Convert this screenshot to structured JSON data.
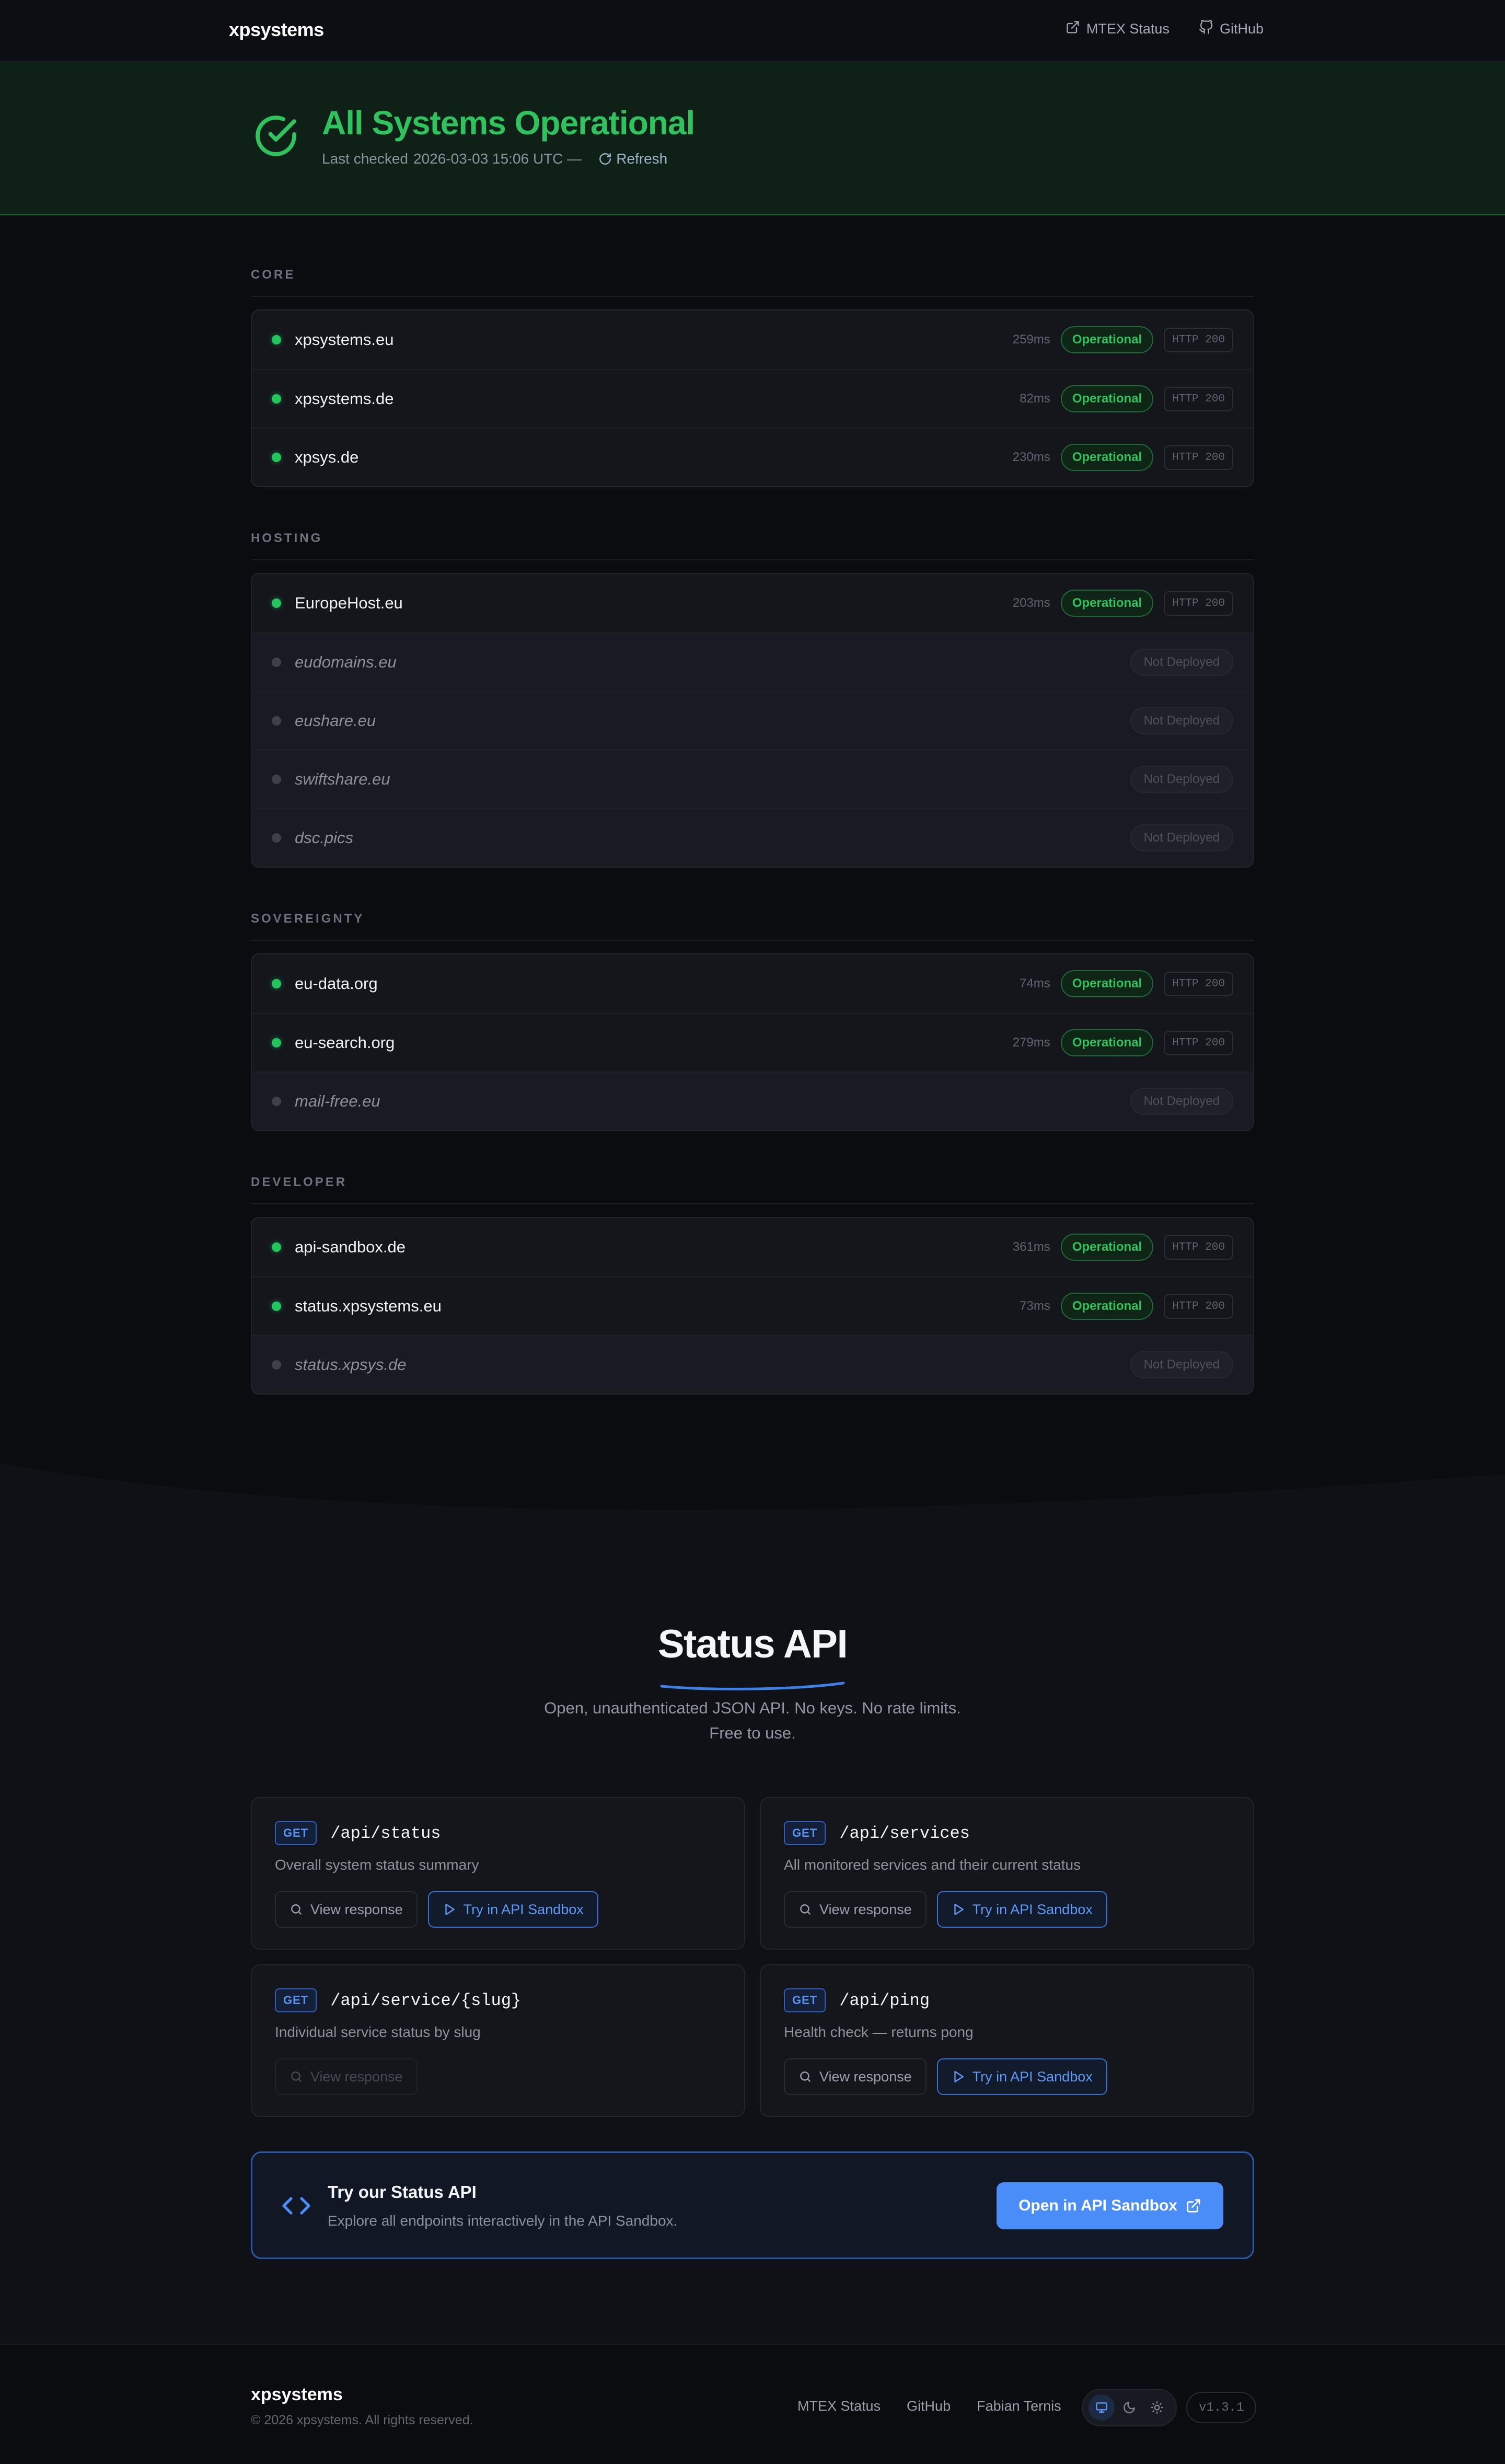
{
  "nav": {
    "logo": "xpsystems",
    "links": [
      {
        "label": "MTEX Status",
        "icon": "external-link-icon"
      },
      {
        "label": "GitHub",
        "icon": "github-icon"
      }
    ]
  },
  "hero": {
    "title": "All Systems Operational",
    "last_checked_label": "Last checked",
    "last_checked_value": "2026-03-03 15:06 UTC —",
    "refresh_label": "Refresh"
  },
  "groups": [
    {
      "label": "CORE",
      "services": [
        {
          "name": "xpsystems.eu",
          "ms": "259ms",
          "status": "Operational",
          "http": "HTTP 200"
        },
        {
          "name": "xpsystems.de",
          "ms": "82ms",
          "status": "Operational",
          "http": "HTTP 200"
        },
        {
          "name": "xpsys.de",
          "ms": "230ms",
          "status": "Operational",
          "http": "HTTP 200"
        }
      ]
    },
    {
      "label": "HOSTING",
      "services": [
        {
          "name": "EuropeHost.eu",
          "ms": "203ms",
          "status": "Operational",
          "http": "HTTP 200"
        },
        {
          "name": "eudomains.eu",
          "status": "Not Deployed"
        },
        {
          "name": "eushare.eu",
          "status": "Not Deployed"
        },
        {
          "name": "swiftshare.eu",
          "status": "Not Deployed"
        },
        {
          "name": "dsc.pics",
          "status": "Not Deployed"
        }
      ]
    },
    {
      "label": "SOVEREIGNTY",
      "services": [
        {
          "name": "eu-data.org",
          "ms": "74ms",
          "status": "Operational",
          "http": "HTTP 200"
        },
        {
          "name": "eu-search.org",
          "ms": "279ms",
          "status": "Operational",
          "http": "HTTP 200"
        },
        {
          "name": "mail-free.eu",
          "status": "Not Deployed"
        }
      ]
    },
    {
      "label": "DEVELOPER",
      "services": [
        {
          "name": "api-sandbox.de",
          "ms": "361ms",
          "status": "Operational",
          "http": "HTTP 200"
        },
        {
          "name": "status.xpsystems.eu",
          "ms": "73ms",
          "status": "Operational",
          "http": "HTTP 200"
        },
        {
          "name": "status.xpsys.de",
          "status": "Not Deployed"
        }
      ]
    }
  ],
  "api": {
    "title": "Status API",
    "desc_line1": "Open, unauthenticated JSON API. No keys. No rate limits.",
    "desc_line2": "Free to use.",
    "view_label": "View response",
    "sandbox_label": "Try in API Sandbox",
    "endpoints": [
      {
        "method": "GET",
        "path": "/api/status",
        "desc": "Overall system status summary"
      },
      {
        "method": "GET",
        "path": "/api/services",
        "desc": "All monitored services and their current status"
      },
      {
        "method": "GET",
        "path": "/api/service/{slug}",
        "desc": "Individual service status by slug"
      },
      {
        "method": "GET",
        "path": "/api/ping",
        "desc": "Health check — returns pong"
      }
    ]
  },
  "cta": {
    "title": "Try our Status API",
    "desc": "Explore all endpoints interactively in the API Sandbox.",
    "button": "Open in API Sandbox"
  },
  "footer": {
    "logo": "xpsystems",
    "copyright": "© 2026 xpsystems. All rights reserved.",
    "links": [
      "MTEX Status",
      "GitHub",
      "Fabian Ternis"
    ],
    "version": "v1.3.1"
  },
  "colors": {
    "accent_green": "#2fc25e",
    "accent_blue": "#4b8df8",
    "background": "#0b0c10"
  }
}
